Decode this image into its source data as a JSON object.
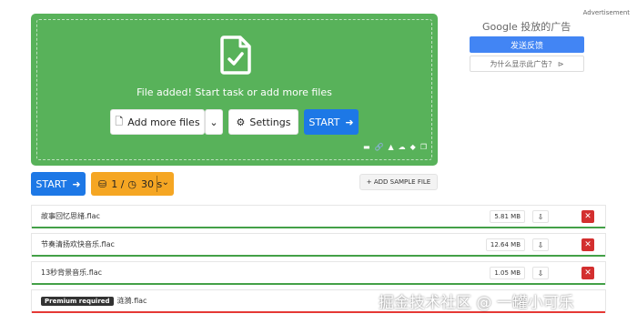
{
  "dropzone": {
    "message": "File added! Start task or add more files",
    "add_more_label": "Add more files",
    "settings_label": "Settings",
    "start_label": "START",
    "sources": [
      "folder-icon",
      "link-icon",
      "google-drive-icon",
      "onedrive-icon",
      "dropbox-icon",
      "clipboard-icon"
    ]
  },
  "actions": {
    "start_label": "START",
    "limit_count": "1 /",
    "limit_time": "30 s",
    "add_sample_label": "+ ADD SAMPLE FILE"
  },
  "files": [
    {
      "name": "故事回忆思绪.flac",
      "size": "5.81 MB"
    },
    {
      "name": "节奏清扬欢快音乐.flac",
      "size": "12.64 MB"
    },
    {
      "name": "13秒背景音乐.flac",
      "size": "1.05 MB"
    },
    {
      "badge": "Premium required",
      "name": "涟漪.flac"
    }
  ],
  "ad": {
    "label": "Advertisement",
    "google": "Google 投放的广告",
    "feedback": "发送反馈",
    "why": "为什么显示此广告？ ⊳"
  },
  "watermark": "掘金技术社区 @ 一罐小可乐",
  "colors": {
    "dropzone": "#58b25a",
    "primary": "#1d78e6",
    "limit": "#f5a623",
    "delete": "#d32f2f"
  }
}
